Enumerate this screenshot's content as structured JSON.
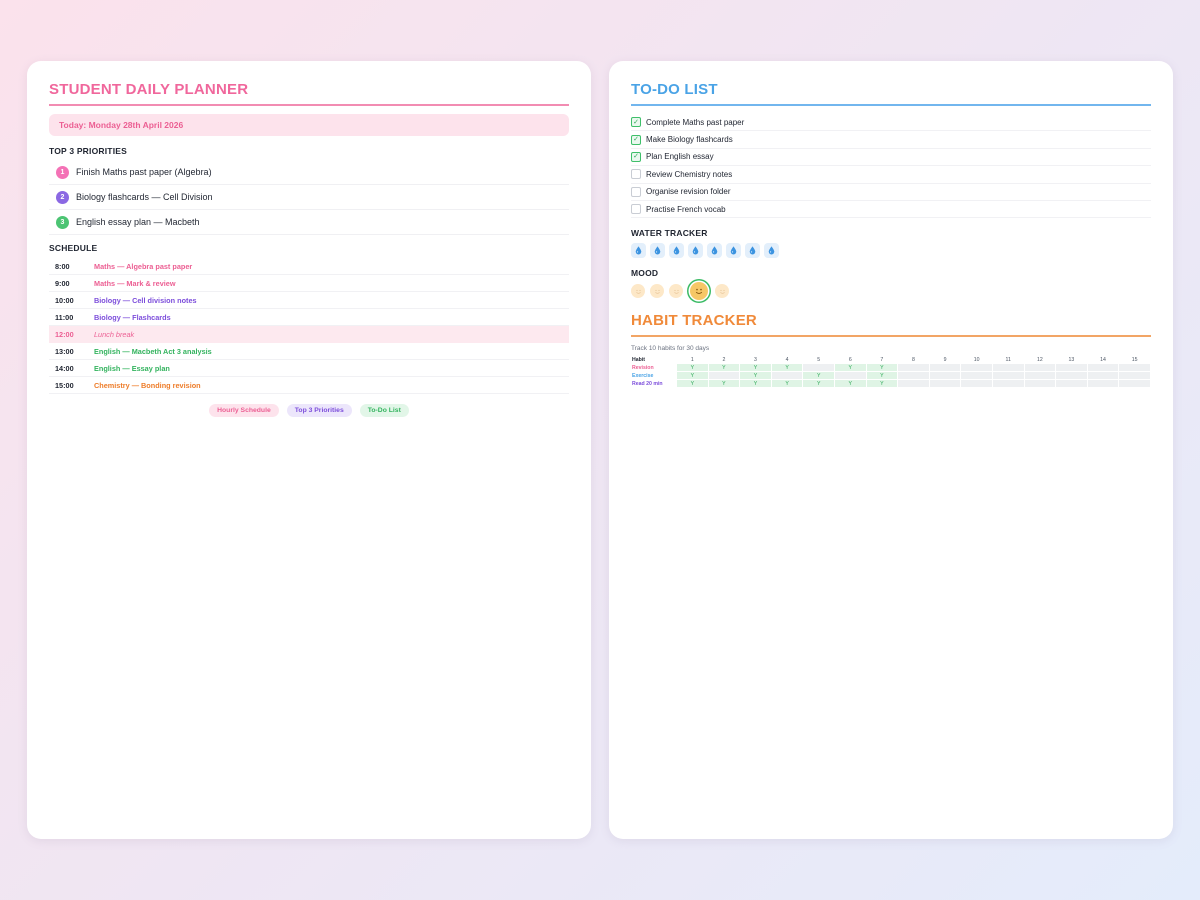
{
  "planner": {
    "title": "STUDENT DAILY PLANNER",
    "date_label": "Today: Monday 28th April 2026",
    "priorities_label": "TOP 3 PRIORITIES",
    "priorities": [
      {
        "num": "1",
        "text": "Finish Maths past paper (Algebra)",
        "color": "#f472b6"
      },
      {
        "num": "2",
        "text": "Biology flashcards — Cell Division",
        "color": "#8b68e3"
      },
      {
        "num": "3",
        "text": "English essay plan — Macbeth",
        "color": "#4cc473"
      }
    ],
    "schedule_label": "SCHEDULE",
    "schedule": [
      {
        "time": "8:00",
        "task": "Maths — Algebra past paper",
        "color": "#ec5f93"
      },
      {
        "time": "9:00",
        "task": "Maths — Mark & review",
        "color": "#ec5f93"
      },
      {
        "time": "10:00",
        "task": "Biology — Cell division notes",
        "color": "#7c4ddb"
      },
      {
        "time": "11:00",
        "task": "Biology — Flashcards",
        "color": "#7c4ddb"
      },
      {
        "time": "12:00",
        "task": "Lunch break",
        "color": "#ec5f93",
        "highlight": true
      },
      {
        "time": "13:00",
        "task": "English — Macbeth Act 3 analysis",
        "color": "#33b35e"
      },
      {
        "time": "14:00",
        "task": "English — Essay plan",
        "color": "#33b35e"
      },
      {
        "time": "15:00",
        "task": "Chemistry — Bonding revision",
        "color": "#ee7d2a"
      }
    ],
    "tags": [
      {
        "label": "Hourly Schedule",
        "bg": "#fde3ec",
        "fg": "#ec5f93"
      },
      {
        "label": "Top 3 Priorities",
        "bg": "#ece6fb",
        "fg": "#7c4ddb"
      },
      {
        "label": "To-Do List",
        "bg": "#e2f6e8",
        "fg": "#33b35e"
      }
    ]
  },
  "todo": {
    "title": "TO-DO LIST",
    "items": [
      {
        "text": "Complete Maths past paper",
        "checked": true
      },
      {
        "text": "Make Biology flashcards",
        "checked": true
      },
      {
        "text": "Plan English essay",
        "checked": true
      },
      {
        "text": "Review Chemistry notes",
        "checked": false
      },
      {
        "text": "Organise revision folder",
        "checked": false
      },
      {
        "text": "Practise French vocab",
        "checked": false
      }
    ],
    "check_glyph": "✓"
  },
  "water": {
    "label": "WATER TRACKER",
    "icon": "water-drop-icon",
    "glasses_total": 8
  },
  "mood": {
    "label": "MOOD",
    "icon": "mood-face-icon",
    "options_total": 5,
    "selected_index": 3
  },
  "habit": {
    "title": "HABIT TRACKER",
    "subtitle": "Track 10 habits for 30 days",
    "header_label": "Habit",
    "days": [
      "1",
      "2",
      "3",
      "4",
      "5",
      "6",
      "7",
      "8",
      "9",
      "10",
      "11",
      "12",
      "13",
      "14",
      "15"
    ],
    "mark": "Y",
    "rows": [
      {
        "name": "Revision",
        "color": "#ec5f93",
        "done": [
          1,
          2,
          3,
          4,
          6,
          7
        ]
      },
      {
        "name": "Exercise",
        "color": "#4aa3e6",
        "done": [
          1,
          3,
          5,
          7
        ]
      },
      {
        "name": "Read 20 min",
        "color": "#7c4ddb",
        "done": [
          1,
          2,
          3,
          4,
          5,
          6,
          7
        ]
      }
    ]
  },
  "colors": {
    "pink": "#f0679c",
    "blue": "#4aa3e6",
    "orange": "#f08a3a",
    "green": "#3cbb66",
    "purple": "#7c4ddb"
  }
}
